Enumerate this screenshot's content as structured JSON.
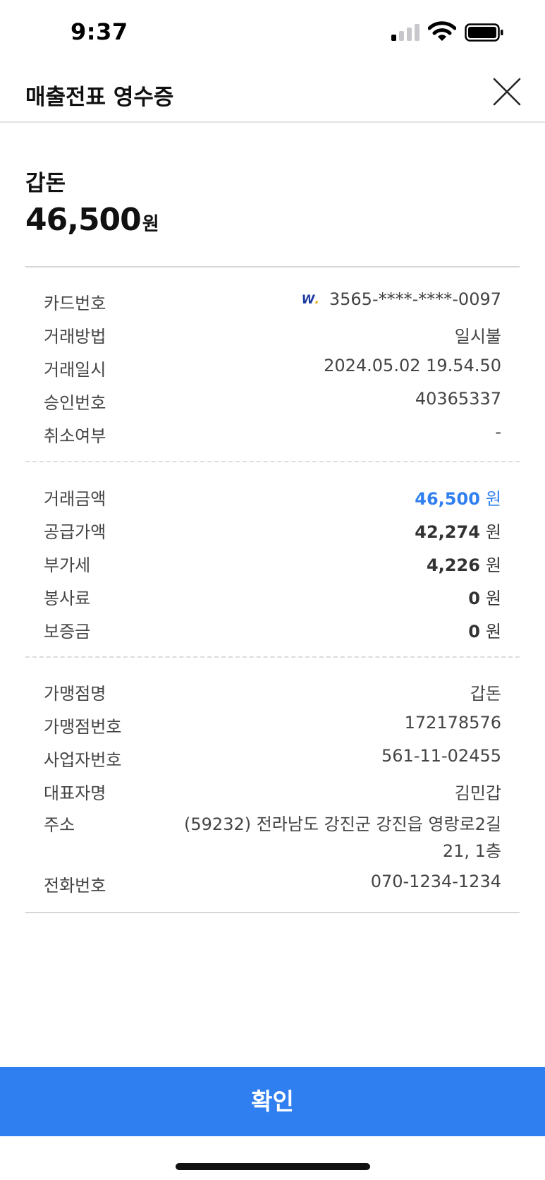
{
  "status_bar": {
    "time": "9:37",
    "signal_bars_active": 1,
    "signal_bars_total": 4
  },
  "header": {
    "title": "매출전표 영수증",
    "close_icon": "close-icon"
  },
  "summary": {
    "merchant_name": "갑돈",
    "amount": "46,500",
    "unit": "원"
  },
  "card_section": [
    {
      "label": "카드번호",
      "value": "3565-****-****-0097",
      "icon": "card-brand-logo"
    },
    {
      "label": "거래방법",
      "value": "일시불"
    },
    {
      "label": "거래일시",
      "value": "2024.05.02 19.54.50"
    },
    {
      "label": "승인번호",
      "value": "40365337"
    },
    {
      "label": "취소여부",
      "value": "-"
    }
  ],
  "amount_section": [
    {
      "label": "거래금액",
      "value": "46,500",
      "unit": "원"
    },
    {
      "label": "공급가액",
      "value": "42,274",
      "unit": "원"
    },
    {
      "label": "부가세",
      "value": "4,226",
      "unit": "원"
    },
    {
      "label": "봉사료",
      "value": "0",
      "unit": "원"
    },
    {
      "label": "보증금",
      "value": "0",
      "unit": "원"
    }
  ],
  "merchant_section": [
    {
      "label": "가맹점명",
      "value": "갑돈"
    },
    {
      "label": "가맹점번호",
      "value": "172178576"
    },
    {
      "label": "사업자번호",
      "value": "561-11-02455"
    },
    {
      "label": "대표자명",
      "value": "김민갑"
    },
    {
      "label": "주소",
      "value": "(59232) 전라남도 강진군 강진읍 영랑로2길 21, 1층"
    },
    {
      "label": "전화번호",
      "value": "070-1234-1234"
    }
  ],
  "footer": {
    "confirm_label": "확인"
  },
  "colors": {
    "accent": "#2f7ff0",
    "text": "#444444",
    "divider": "#d6d6d6"
  }
}
